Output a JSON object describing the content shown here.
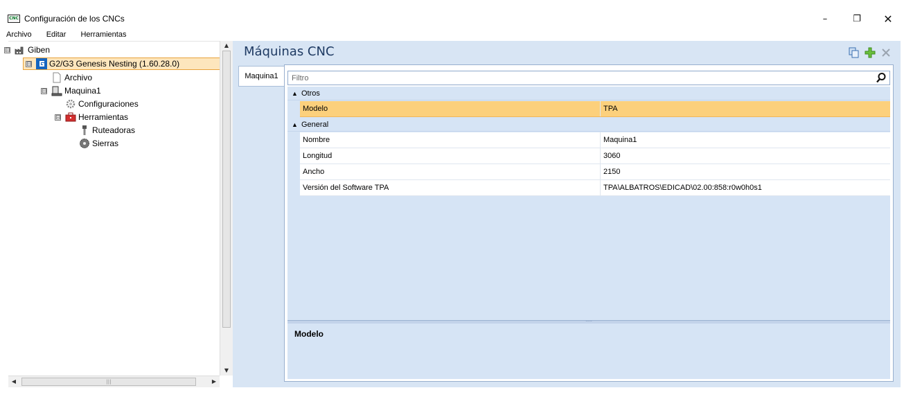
{
  "window": {
    "app_icon_text": "CNC",
    "title": "Configuración de los CNCs",
    "controls": {
      "minimize": "–",
      "maximize": "❐",
      "close": "✕"
    }
  },
  "menu": [
    "Archivo",
    "Editar",
    "Herramientas"
  ],
  "tree": {
    "items": [
      {
        "label": "Giben",
        "expander": "⊟"
      },
      {
        "label": "G2/G3 Genesis Nesting (1.60.28.0)",
        "expander": "⊟"
      },
      {
        "label": "Archivo"
      },
      {
        "label": "Maquina1",
        "expander": "⊟"
      },
      {
        "label": "Configuraciones"
      },
      {
        "label": "Herramientas",
        "expander": "⊟"
      },
      {
        "label": "Ruteadoras"
      },
      {
        "label": "Sierras"
      }
    ]
  },
  "main": {
    "title": "Máquinas CNC",
    "tab": "Maquina1",
    "filter_placeholder": "Filtro",
    "categories": [
      {
        "name": "Otros",
        "rows": [
          {
            "name": "Modelo",
            "value": "TPA"
          }
        ]
      },
      {
        "name": "General",
        "rows": [
          {
            "name": "Nombre",
            "value": "Maquina1"
          },
          {
            "name": "Longitud",
            "value": "3060"
          },
          {
            "name": "Ancho",
            "value": "2150"
          },
          {
            "name": "Versión del Software TPA",
            "value": "TPA\\ALBATROS\\EDICAD\\02.00:858:r0w0h0s1"
          }
        ]
      }
    ],
    "description_title": "Modelo"
  },
  "colors": {
    "panel_bg": "#d8e5f4",
    "selected_row": "#fcd07c",
    "tree_selected": "#fde6bd",
    "accent_green": "#3fa53f",
    "title_blue": "#1f3b63"
  }
}
